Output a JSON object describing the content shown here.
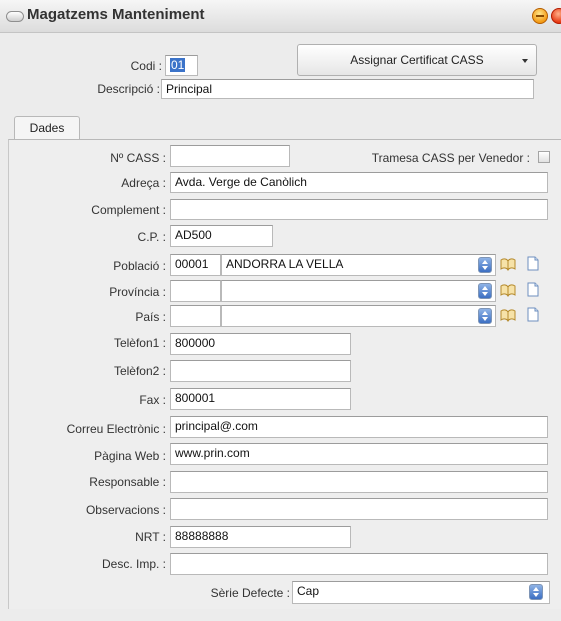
{
  "window": {
    "title": "Magatzems Manteniment"
  },
  "header": {
    "codi_label": "Codi :",
    "codi_value": "01",
    "descripcio_label": "Descripció :",
    "descripcio_value": "Principal",
    "assign_button_label": "Assignar Certificat CASS"
  },
  "tabs": [
    {
      "label": "Dades",
      "selected": true
    }
  ],
  "form": {
    "ncass_label": "Nº CASS :",
    "ncass_value": "",
    "tramesa_label": "Tramesa CASS per Venedor :",
    "tramesa_checked": false,
    "adreca_label": "Adreça :",
    "adreca_value": "Avda. Verge de Canòlich",
    "complement_label": "Complement :",
    "complement_value": "",
    "cp_label": "C.P. :",
    "cp_value": "AD500",
    "poblacio_label": "Població :",
    "poblacio_code": "00001",
    "poblacio_name": "ANDORRA LA VELLA",
    "provincia_label": "Província :",
    "provincia_code": "",
    "provincia_name": "",
    "pais_label": "País :",
    "pais_code": "",
    "pais_name": "",
    "telefon1_label": "Telèfon1 :",
    "telefon1_value": "800000",
    "telefon2_label": "Telèfon2 :",
    "telefon2_value": "",
    "fax_label": "Fax :",
    "fax_value": "800001",
    "correu_label": "Correu Electrònic :",
    "correu_value": "principal@.com",
    "web_label": "Pàgina Web :",
    "web_value": "www.prin.com",
    "responsable_label": "Responsable :",
    "responsable_value": "",
    "observacions_label": "Observacions :",
    "observacions_value": "",
    "nrt_label": "NRT :",
    "nrt_value": "88888888",
    "descimp_label": "Desc. Imp. :",
    "descimp_value": "",
    "serie_label": "Sèrie Defecte :",
    "serie_value": "Cap"
  },
  "colors": {
    "selection": "#3b73c9",
    "window_button_orange": "#f39a14",
    "window_button_red": "#e63912"
  }
}
